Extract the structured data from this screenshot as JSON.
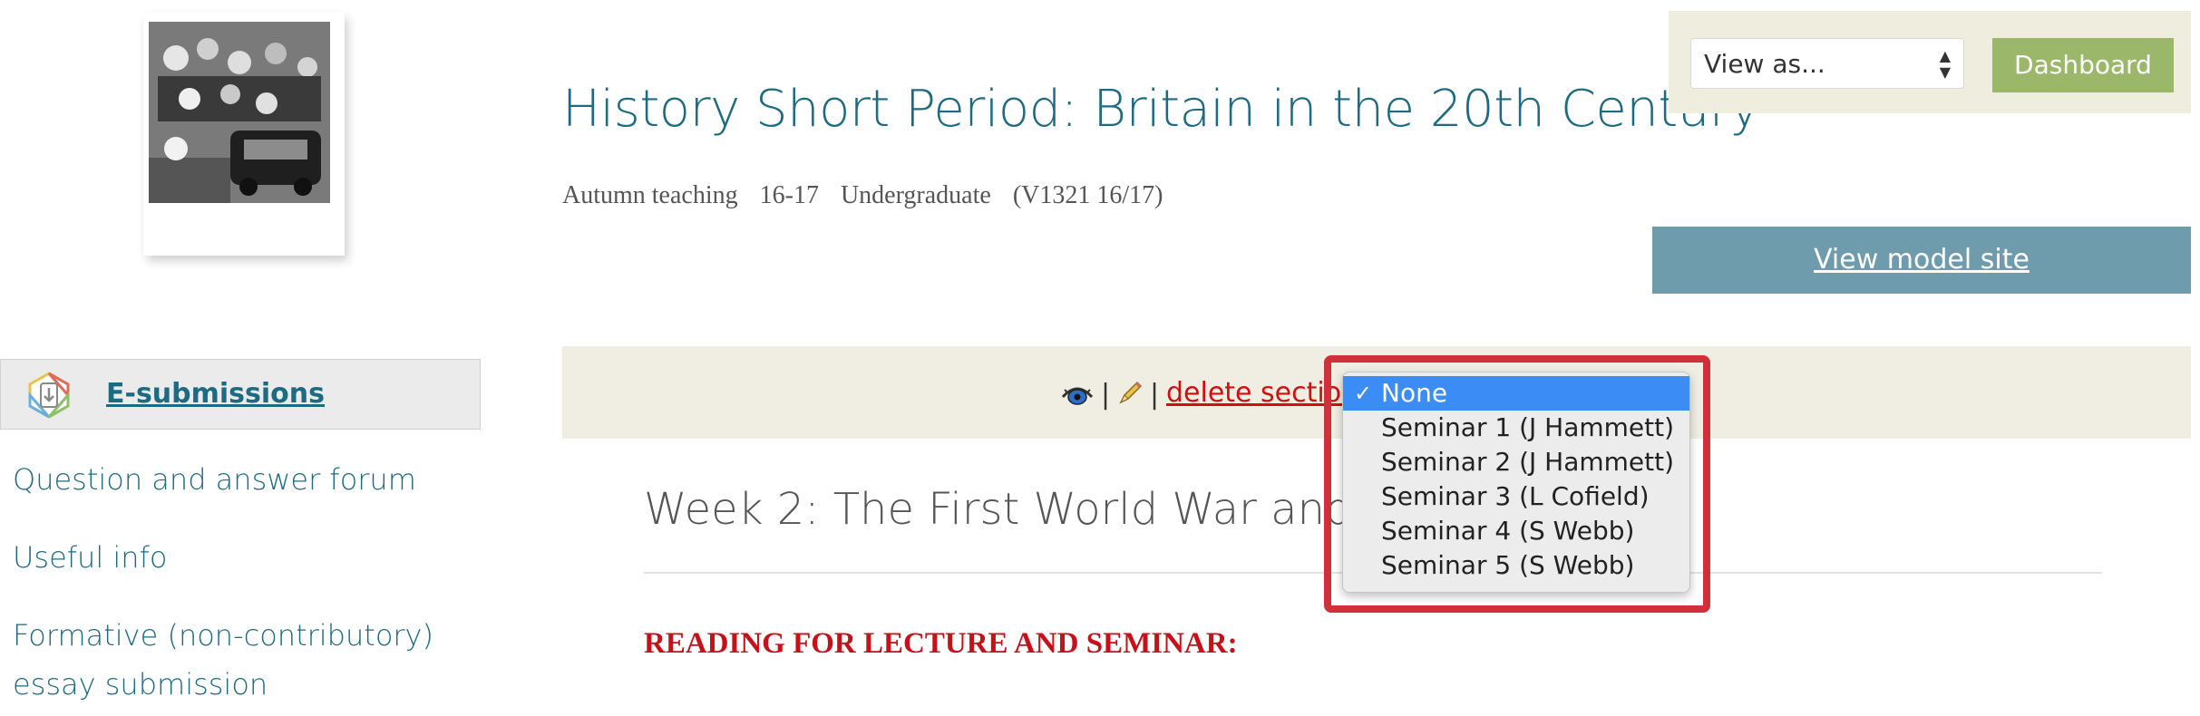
{
  "header": {
    "title": "History Short Period: Britain in the 20th Century",
    "meta": {
      "term": "Autumn teaching",
      "year": "16-17",
      "level": "Undergraduate",
      "code": "(V1321 16/17)"
    }
  },
  "controls": {
    "view_as_label": "View as...",
    "dashboard_label": "Dashboard",
    "model_site_label": "View model site"
  },
  "sidebar": {
    "esubmissions_label": "E-submissions",
    "links": [
      "Question and answer forum",
      "Useful info",
      "Formative (non-contributory)",
      "essay submission"
    ]
  },
  "section": {
    "pipe": "|",
    "delete_label": "delete section",
    "week_title": "Week 2: The First World War and So",
    "reading_heading": "READING FOR LECTURE AND SEMINAR:"
  },
  "dropdown": {
    "checkmark": "✓",
    "options": [
      "None",
      "Seminar 1 (J Hammett)",
      "Seminar 2 (J Hammett)",
      "Seminar 3 (L Cofield)",
      "Seminar 4 (S Webb)",
      "Seminar 5 (S Webb)"
    ],
    "selected": "None"
  },
  "colors": {
    "accent": "#1d6a82",
    "dashboard": "#9bb86a",
    "model_site": "#6f9cad",
    "danger": "#d01010",
    "highlight": "#d0303a",
    "selection": "#3b8cf5"
  },
  "icons": [
    "course-photo",
    "esubmission-icon",
    "eye-icon",
    "pencil-icon",
    "checkmark-icon",
    "select-arrows-icon"
  ]
}
